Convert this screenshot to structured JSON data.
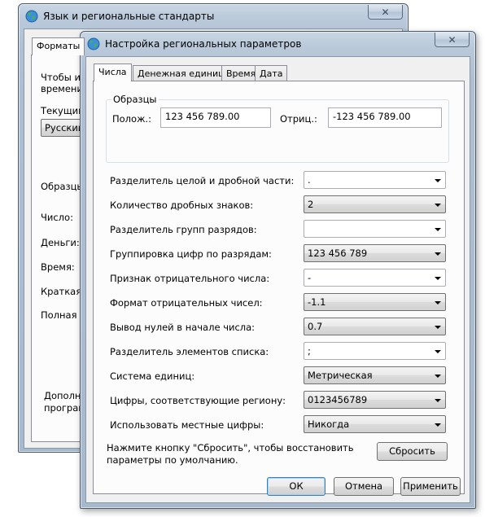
{
  "back_window": {
    "title": "Язык и региональные стандарты",
    "close_label": "✕",
    "tab_formats": "Форматы",
    "line1": "Чтобы из",
    "line2": "времени,",
    "current_label": "Текущий",
    "current_value": "Русский",
    "samples_label": "Образцы",
    "number_label": "Число:",
    "money_label": "Деньги:",
    "time_label": "Время:",
    "short_date_label": "Краткая д",
    "long_date_label": "Полная д",
    "extra_line1": "Дополни",
    "extra_line2": "програм"
  },
  "front_window": {
    "title": "Настройка региональных параметров",
    "close_label": "✕",
    "tabs": [
      {
        "label": "Числа",
        "active": true
      },
      {
        "label": "Денежная единица",
        "active": false
      },
      {
        "label": "Время",
        "active": false
      },
      {
        "label": "Дата",
        "active": false
      }
    ],
    "samples": {
      "group_title": "Образцы",
      "positive_label": "Полож.:",
      "positive_value": "123 456 789.00",
      "negative_label": "Отриц.:",
      "negative_value": "-123 456 789.00"
    },
    "settings": [
      {
        "label": "Разделитель целой и дробной части:",
        "value": ".",
        "editable": true
      },
      {
        "label": "Количество дробных знаков:",
        "value": "2",
        "editable": false
      },
      {
        "label": "Разделитель групп разрядов:",
        "value": "",
        "editable": true
      },
      {
        "label": "Группировка цифр по разрядам:",
        "value": "123 456 789",
        "editable": false
      },
      {
        "label": "Признак отрицательного числа:",
        "value": "-",
        "editable": true
      },
      {
        "label": "Формат отрицательных чисел:",
        "value": "-1.1",
        "editable": false
      },
      {
        "label": "Вывод нулей в начале числа:",
        "value": "0.7",
        "editable": false
      },
      {
        "label": "Разделитель элементов списка:",
        "value": ";",
        "editable": true
      },
      {
        "label": "Система единиц:",
        "value": "Метрическая",
        "editable": false
      },
      {
        "label": "Цифры, соответствующие региону:",
        "value": "0123456789",
        "editable": false
      },
      {
        "label": "Использовать местные цифры:",
        "value": "Никогда",
        "editable": false
      }
    ],
    "reset_hint_line1": "Нажмите кнопку \"Сбросить\", чтобы восстановить",
    "reset_hint_line2": "параметры по умолчанию.",
    "reset_button": "Сбросить",
    "ok_button": "ОК",
    "cancel_button": "Отмена",
    "apply_button": "Применить"
  }
}
